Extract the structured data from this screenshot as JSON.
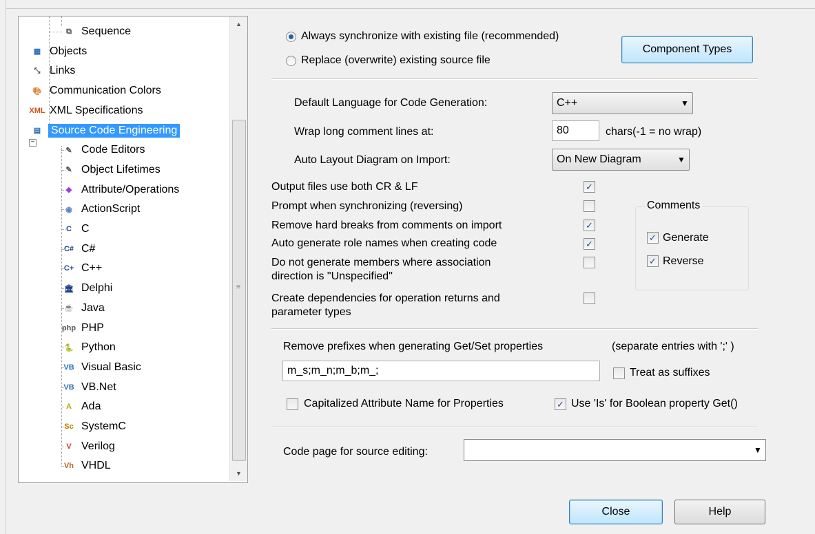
{
  "tree": {
    "items": [
      {
        "label": "Sequence",
        "icon": "sequence-icon",
        "glyph": "⧉",
        "color": "#555"
      },
      {
        "label": "Objects",
        "icon": "objects-icon",
        "glyph": "▦",
        "color": "#2c6fbb"
      },
      {
        "label": "Links",
        "icon": "links-icon",
        "glyph": "⤡",
        "color": "#555"
      },
      {
        "label": "Communication Colors",
        "icon": "palette-icon",
        "glyph": "🎨",
        "color": "#c47a00"
      },
      {
        "label": "XML Specifications",
        "icon": "xml-icon",
        "glyph": "XML",
        "color": "#d0501a"
      },
      {
        "label": "Source Code Engineering",
        "icon": "source-code-icon",
        "glyph": "▤",
        "color": "#2c6fbb"
      },
      {
        "label": "Code Editors",
        "icon": "code-editors-icon",
        "glyph": "✎",
        "color": "#555"
      },
      {
        "label": "Object Lifetimes",
        "icon": "object-lifetimes-icon",
        "glyph": "✎",
        "color": "#555"
      },
      {
        "label": "Attribute/Operations",
        "icon": "attribute-operations-icon",
        "glyph": "◆",
        "color": "#9a3fd0"
      },
      {
        "label": "ActionScript",
        "icon": "actionscript-icon",
        "glyph": "◉",
        "color": "#5b7fd0"
      },
      {
        "label": "C",
        "icon": "c-language-icon",
        "glyph": "C",
        "color": "#1d3f8a"
      },
      {
        "label": "C#",
        "icon": "csharp-icon",
        "glyph": "C#",
        "color": "#1d3f8a"
      },
      {
        "label": "C++",
        "icon": "cpp-icon",
        "glyph": "C+",
        "color": "#1d3f8a"
      },
      {
        "label": "Delphi",
        "icon": "delphi-icon",
        "glyph": "🏛",
        "color": "#1d3f8a"
      },
      {
        "label": "Java",
        "icon": "java-icon",
        "glyph": "☕",
        "color": "#c0392b"
      },
      {
        "label": "PHP",
        "icon": "php-icon",
        "glyph": "php",
        "color": "#555"
      },
      {
        "label": "Python",
        "icon": "python-icon",
        "glyph": "🐍",
        "color": "#2e8b2e"
      },
      {
        "label": "Visual Basic",
        "icon": "visual-basic-icon",
        "glyph": "VB",
        "color": "#2c6fbb"
      },
      {
        "label": "VB.Net",
        "icon": "vbnet-icon",
        "glyph": "VB",
        "color": "#2c6fbb"
      },
      {
        "label": "Ada",
        "icon": "ada-icon",
        "glyph": "A",
        "color": "#b8a000"
      },
      {
        "label": "SystemC",
        "icon": "systemc-icon",
        "glyph": "Sc",
        "color": "#c47a00"
      },
      {
        "label": "Verilog",
        "icon": "verilog-icon",
        "glyph": "V",
        "color": "#c0392b"
      },
      {
        "label": "VHDL",
        "icon": "vhdl-icon",
        "glyph": "Vh",
        "color": "#b5651d"
      }
    ]
  },
  "sync": {
    "always_label": "Always synchronize with existing file (recommended)",
    "replace_label": "Replace (overwrite) existing source file",
    "component_types_button": "Component Types"
  },
  "settings": {
    "default_language_label": "Default Language for Code Generation:",
    "default_language_value": "C++",
    "wrap_label": "Wrap long comment lines at:",
    "wrap_value": "80",
    "wrap_suffix": "chars(-1 = no wrap)",
    "auto_layout_label": "Auto Layout Diagram on Import:",
    "auto_layout_value": "On New Diagram"
  },
  "options": [
    {
      "label": "Output files use both CR & LF",
      "checked": true
    },
    {
      "label": "Prompt when synchronizing (reversing)",
      "checked": false
    },
    {
      "label": "Remove hard breaks from  comments on import",
      "checked": true
    },
    {
      "label": "Auto generate role names when creating code",
      "checked": true
    },
    {
      "label": "Do not generate members where association\ndirection is \"Unspecified\"",
      "checked": false
    },
    {
      "label": "Create dependencies for operation returns and\nparameter types",
      "checked": false
    }
  ],
  "comments": {
    "title": "Comments",
    "generate_label": "Generate",
    "reverse_label": "Reverse"
  },
  "prefixes": {
    "label": "Remove prefixes when generating Get/Set properties",
    "hint": "(separate entries with ';' )",
    "value": "m_s;m_n;m_b;m_;",
    "treat_suffix_label": "Treat as suffixes",
    "capitalized_label": "Capitalized Attribute Name for Properties",
    "use_is_label": "Use 'Is' for Boolean property Get()"
  },
  "codepage": {
    "label": "Code page for source editing:",
    "value": ""
  },
  "footer": {
    "close_label": "Close",
    "help_label": "Help"
  }
}
